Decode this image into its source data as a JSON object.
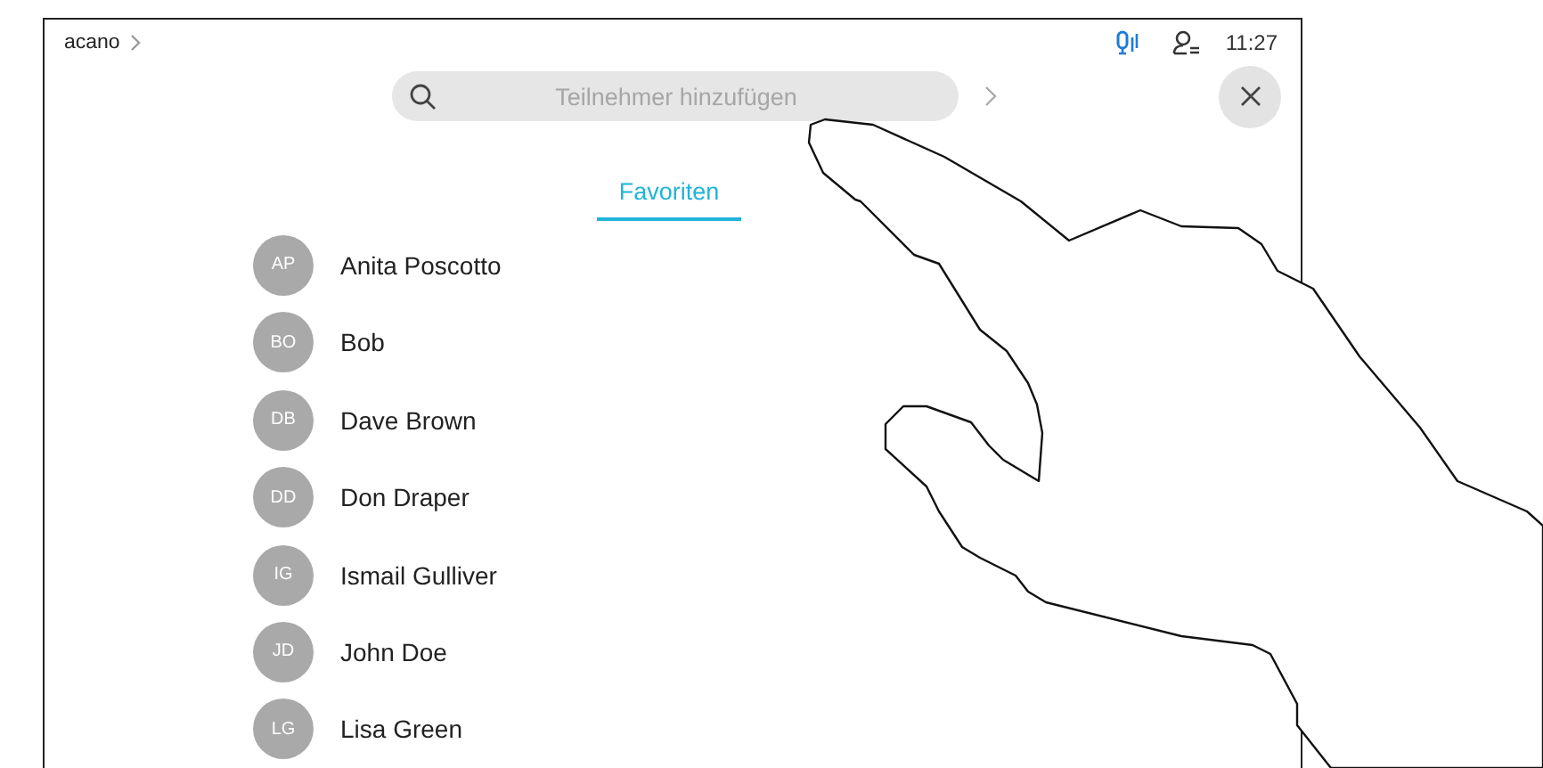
{
  "top_bar": {
    "breadcrumb": "acano",
    "time": "11:27"
  },
  "search": {
    "placeholder": "Teilnehmer hinzufügen"
  },
  "tabs": [
    {
      "label": "Favoriten",
      "selected": true
    }
  ],
  "contacts": [
    {
      "initials": "AP",
      "name": "Anita Poscotto"
    },
    {
      "initials": "BO",
      "name": "Bob"
    },
    {
      "initials": "DB",
      "name": "Dave Brown"
    },
    {
      "initials": "DD",
      "name": "Don Draper"
    },
    {
      "initials": "IG",
      "name": "Ismail Gulliver"
    },
    {
      "initials": "JD",
      "name": "John Doe"
    },
    {
      "initials": "LG",
      "name": "Lisa Green"
    }
  ]
}
